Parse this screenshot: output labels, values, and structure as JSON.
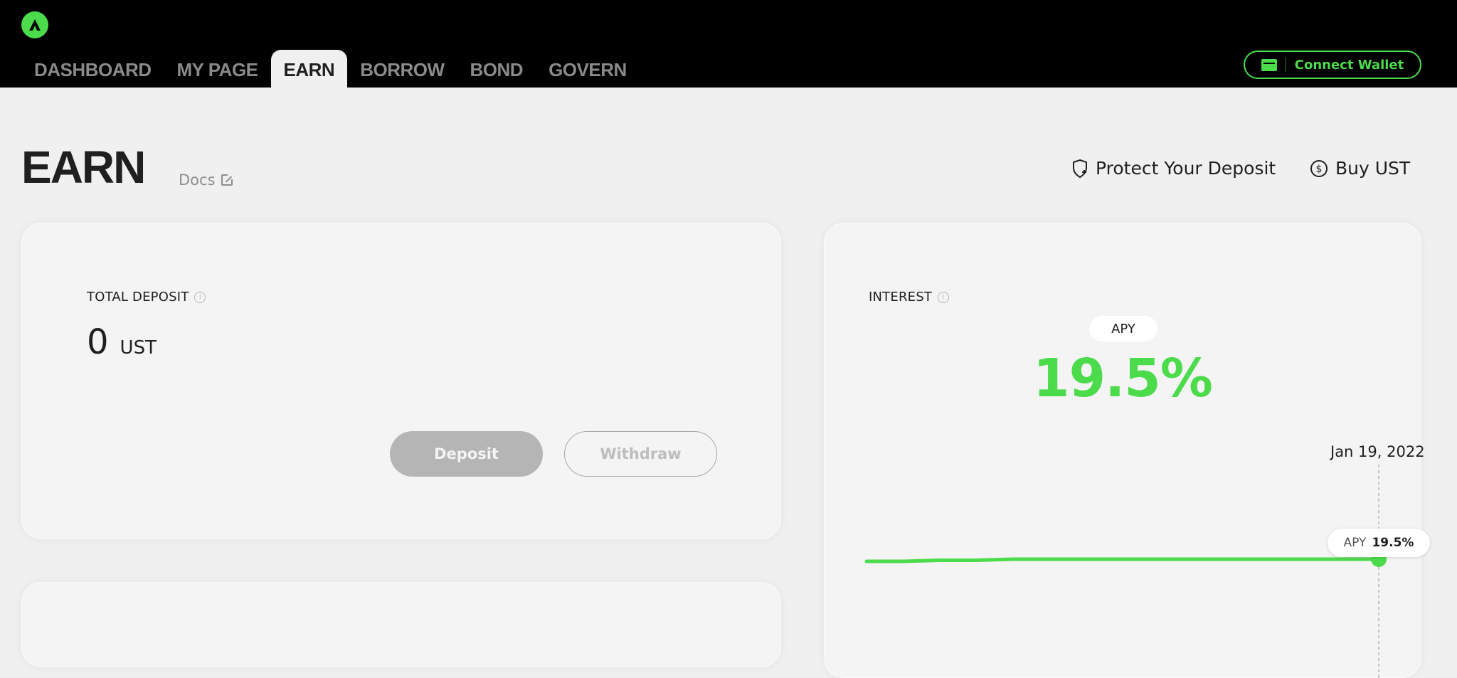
{
  "nav": {
    "items": [
      {
        "label": "DASHBOARD"
      },
      {
        "label": "MY PAGE"
      },
      {
        "label": "EARN"
      },
      {
        "label": "BORROW"
      },
      {
        "label": "BOND"
      },
      {
        "label": "GOVERN"
      }
    ],
    "active": "EARN",
    "connect_label": "Connect Wallet"
  },
  "header": {
    "title": "EARN",
    "docs_label": "Docs",
    "protect_label": "Protect Your Deposit",
    "buy_label": "Buy UST"
  },
  "deposit_card": {
    "label": "TOTAL DEPOSIT",
    "amount": "0",
    "unit": "UST",
    "deposit_label": "Deposit",
    "withdraw_label": "Withdraw"
  },
  "interest_card": {
    "label": "INTEREST",
    "apy_label": "APY",
    "apy_value": "19.5%",
    "tooltip_date": "Jan 19, 2022",
    "tooltip_label": "APY",
    "tooltip_value": "19.5%"
  },
  "chart_data": {
    "type": "line",
    "series": [
      {
        "name": "APY",
        "values": [
          19.4,
          19.4,
          19.45,
          19.45,
          19.5,
          19.5,
          19.5,
          19.5,
          19.5,
          19.5,
          19.5,
          19.5,
          19.5,
          19.5,
          19.5
        ]
      }
    ],
    "highlight": {
      "x": "Jan 19, 2022",
      "y": 19.5
    },
    "ylim": [
      0,
      40
    ]
  },
  "colors": {
    "accent": "#4bdb4b",
    "text": "#1f1f1f",
    "muted": "#8f8f8f"
  }
}
